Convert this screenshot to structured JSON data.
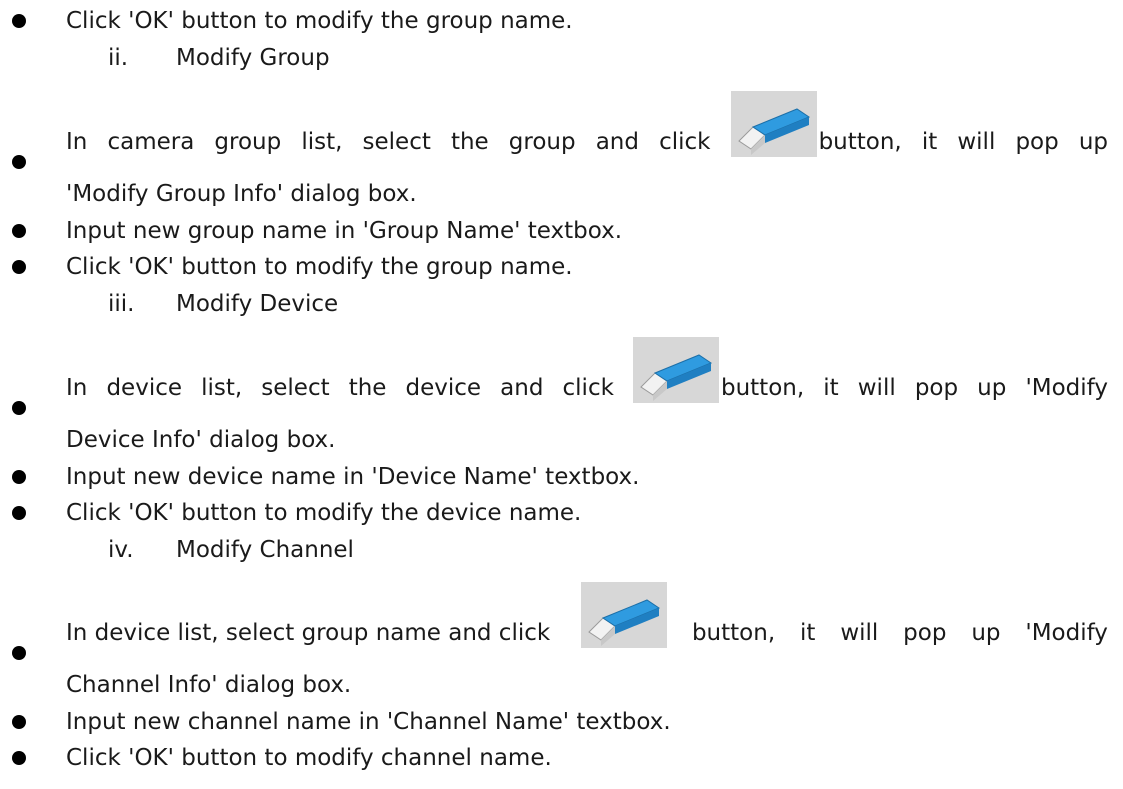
{
  "sections": {
    "top_bullet": "Click 'OK' button to modify the group name.",
    "group": {
      "numeral": "ii.",
      "heading": "Modify Group",
      "b1_words": [
        "In",
        "camera",
        "group",
        "list,",
        "select",
        "the",
        "group",
        "and",
        "click"
      ],
      "b1_after_icon": [
        "button,",
        "it",
        "will",
        "pop",
        "up"
      ],
      "b1_line2": "'Modify Group Info' dialog box.",
      "b2": "Input new group name in 'Group Name' textbox.",
      "b3": "Click 'OK' button to modify the group name."
    },
    "device": {
      "numeral": "iii.",
      "heading": "Modify Device",
      "b1_words": [
        "In",
        "device",
        "list,",
        "select",
        "the",
        "device",
        "and",
        "click"
      ],
      "b1_after_icon": [
        "button,",
        "it",
        "will",
        "pop",
        "up",
        "'Modify"
      ],
      "b1_line2": "Device Info' dialog box.",
      "b2": "Input new device name in 'Device Name' textbox.",
      "b3": "Click 'OK' button to modify the device name."
    },
    "channel": {
      "numeral": "iv.",
      "heading": "Modify Channel",
      "b1_words": [
        "In device list, select group name and click"
      ],
      "b1_after_icon": [
        "button,",
        "it",
        "will",
        "pop",
        "up",
        "'Modify"
      ],
      "b1_line2": "Channel Info' dialog box.",
      "b2": "Input new channel name in 'Channel Name' textbox.",
      "b3": "Click 'OK' button to modify channel name."
    }
  },
  "icon": {
    "name": "modify-icon",
    "body_color": "#2f9be0",
    "cap_color": "#f2f2f2",
    "bg_color": "#d7d7d7"
  }
}
